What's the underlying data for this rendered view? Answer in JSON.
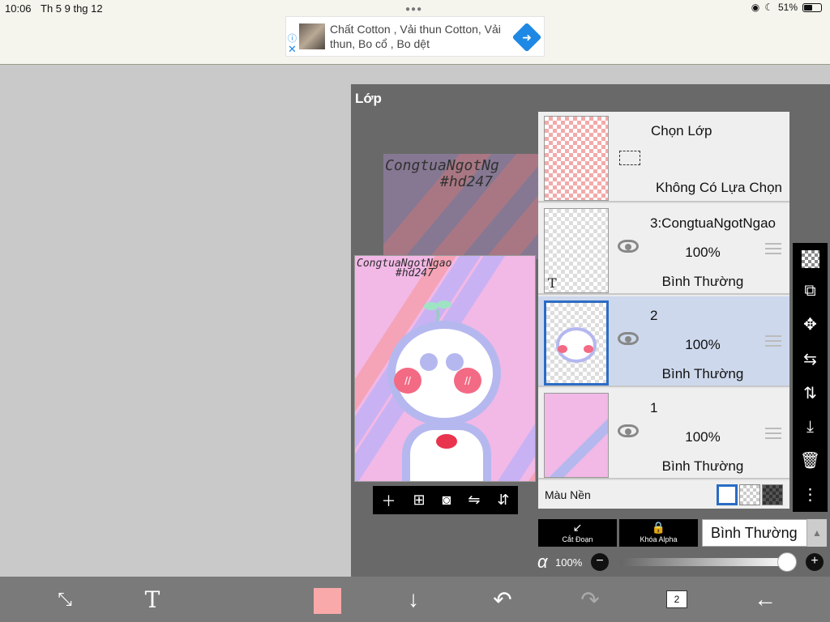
{
  "status_bar": {
    "time": "10:06",
    "date": "Th 5 9 thg 12",
    "battery": "51%"
  },
  "ad": {
    "text": "Chất Cotton , Vải thun Cotton, Vải thun, Bo cổ , Bo dệt",
    "info_icon": "info-icon",
    "close_icon": "close-icon"
  },
  "panel": {
    "title": "Lớp"
  },
  "canvas": {
    "watermark_line1": "CongtuaNgotNgao",
    "watermark_line2": "#hd247",
    "back_watermark_line1": "CongtuaNgotNg",
    "back_watermark_line2": "#hd247"
  },
  "canvas_tools": [
    "add-icon",
    "add-layer-icon",
    "camera-icon",
    "flip-horizontal-icon",
    "flip-vertical-icon"
  ],
  "layers": {
    "selection": {
      "name": "Chọn Lớp",
      "status": "Không Có Lựa Chọn"
    },
    "items": [
      {
        "name": "3:CongtuaNgotNgao",
        "opacity": "100%",
        "mode": "Bình Thường",
        "type_badge": "T",
        "selected": false
      },
      {
        "name": "2",
        "opacity": "100%",
        "mode": "Bình Thường",
        "selected": true
      },
      {
        "name": "1",
        "opacity": "100%",
        "mode": "Bình Thường",
        "selected": false
      }
    ],
    "background_label": "Màu Nền"
  },
  "right_tools": [
    "checker-icon",
    "transform-layer-icon",
    "move-icon",
    "flip-horizontal-icon",
    "flip-vertical-icon",
    "merge-down-icon",
    "trash-icon",
    "more-icon"
  ],
  "controls": {
    "clip_label": "Cắt Đoạn",
    "alpha_lock_label": "Khóa Alpha",
    "blend_mode": "Bình Thường",
    "alpha_symbol": "α",
    "alpha_value": "100%",
    "opacity_fraction": 1.0
  },
  "bottom_bar": {
    "layer_count": "2",
    "primary_color": "#f9a9a9",
    "icons": [
      "transform-icon",
      "text-icon",
      "color-swatch",
      "download-icon",
      "undo-icon",
      "redo-icon",
      "layers-icon",
      "back-icon"
    ]
  },
  "colors": {
    "panel_bg": "#696969",
    "selected_row": "#cdd8ec",
    "accent": "#2b6cc4",
    "bottom_bar": "#7a7a7a"
  }
}
